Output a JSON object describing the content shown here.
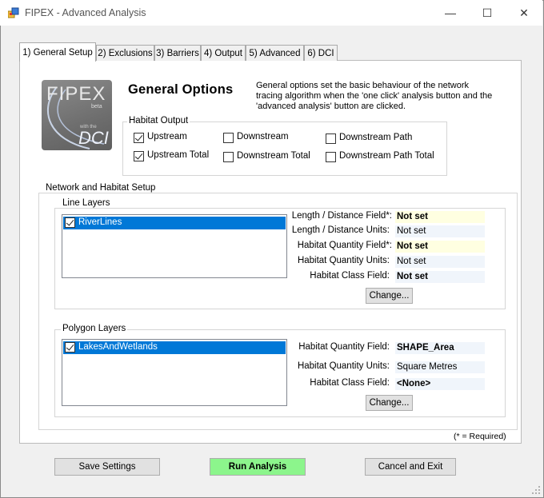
{
  "window": {
    "title": "FIPEX - Advanced Analysis",
    "minimize": "—",
    "maximize": "☐",
    "close": "✕"
  },
  "tabs": [
    {
      "label": "1) General Setup",
      "active": true
    },
    {
      "label": "2) Exclusions",
      "active": false
    },
    {
      "label": "3) Barriers",
      "active": false
    },
    {
      "label": "4) Output",
      "active": false
    },
    {
      "label": "5) Advanced",
      "active": false
    },
    {
      "label": "6) DCI",
      "active": false
    }
  ],
  "logo": {
    "text_top": "FIPEX",
    "text_beta": "beta",
    "text_with": "with the",
    "text_bottom": "DCI"
  },
  "general": {
    "heading": "General Options",
    "description": "General options set the basic behaviour of the network tracing algorithm when the 'one click' analysis button and the 'advanced analysis' button are clicked."
  },
  "habitat_output": {
    "legend": "Habitat Output",
    "options": [
      {
        "label": "Upstream",
        "checked": true
      },
      {
        "label": "Downstream",
        "checked": false
      },
      {
        "label": "Downstream Path",
        "checked": false
      },
      {
        "label": "Upstream Total",
        "checked": true
      },
      {
        "label": "Downstream Total",
        "checked": false
      },
      {
        "label": "Downstream Path Total",
        "checked": false
      }
    ]
  },
  "network": {
    "legend": "Network and Habitat Setup",
    "line_layers": {
      "legend": "Line Layers",
      "items": [
        {
          "label": "RiverLines",
          "checked": true
        }
      ],
      "fields": [
        {
          "label": "Length / Distance Field*:",
          "value": "Not set"
        },
        {
          "label": "Length / Distance Units:",
          "value": "Not set"
        },
        {
          "label": "Habitat Quantity Field*:",
          "value": "Not set"
        },
        {
          "label": "Habitat Quantity Units:",
          "value": "Not set"
        },
        {
          "label": "Habitat Class Field:",
          "value": "Not set"
        }
      ],
      "change_button": "Change..."
    },
    "polygon_layers": {
      "legend": "Polygon Layers",
      "items": [
        {
          "label": "LakesAndWetlands",
          "checked": true
        }
      ],
      "fields": [
        {
          "label": "Habitat Quantity Field:",
          "value": "SHAPE_Area"
        },
        {
          "label": "Habitat Quantity Units:",
          "value": "Square Metres"
        },
        {
          "label": "Habitat Class Field:",
          "value": "<None>"
        }
      ],
      "change_button": "Change..."
    }
  },
  "required_note": "(* = Required)",
  "footer": {
    "save": "Save Settings",
    "run": "Run Analysis",
    "cancel": "Cancel and Exit"
  },
  "colors": {
    "selection": "#0078d7",
    "run_button": "#8cf58c",
    "required_field": "#ffffe1"
  }
}
